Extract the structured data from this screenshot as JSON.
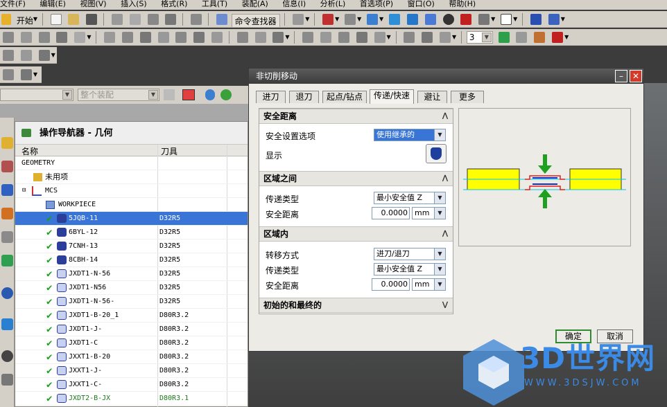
{
  "menubar": {
    "items": [
      "文件(F)",
      "编辑(E)",
      "视图(V)",
      "插入(S)",
      "格式(R)",
      "工具(T)",
      "装配(A)",
      "信息(I)",
      "分析(L)",
      "首选项(P)",
      "窗口(O)",
      "帮助(H)"
    ]
  },
  "toolbar": {
    "start_label": "开始",
    "command_finder_label": "命令查找器",
    "layer_value": "3"
  },
  "filter_bar": {
    "assembly_placeholder": "整个装配"
  },
  "navigator": {
    "title": "操作导航器 - 几何",
    "col_name": "名称",
    "col_tool": "刀具",
    "rows": [
      {
        "name": "GEOMETRY",
        "tool": ""
      },
      {
        "name": "未用项",
        "tool": ""
      },
      {
        "name": "MCS",
        "tool": ""
      },
      {
        "name": "WORKPIECE",
        "tool": ""
      },
      {
        "name": "5JQB-11",
        "tool": "D32R5"
      },
      {
        "name": "6BYL-12",
        "tool": "D32R5"
      },
      {
        "name": "7CNH-13",
        "tool": "D32R5"
      },
      {
        "name": "8CBH-14",
        "tool": "D32R5"
      },
      {
        "name": "JXDT1-N-56",
        "tool": "D32R5"
      },
      {
        "name": "JXDT1-N56",
        "tool": "D32R5"
      },
      {
        "name": "JXDT1-N-56-",
        "tool": "D32R5"
      },
      {
        "name": "JXDT1-B-20_1",
        "tool": "D80R3.2"
      },
      {
        "name": "JXDT1-J-",
        "tool": "D80R3.2"
      },
      {
        "name": "JXDT1-C",
        "tool": "D80R3.2"
      },
      {
        "name": "JXXT1-B-20",
        "tool": "D80R3.2"
      },
      {
        "name": "JXXT1-J-",
        "tool": "D80R3.2"
      },
      {
        "name": "JXXT1-C-",
        "tool": "D80R3.2"
      },
      {
        "name": "JXDT2-B-JX",
        "tool": "D80R3.1"
      }
    ]
  },
  "dialog": {
    "title": "非切削移动",
    "tabs": [
      "进刀",
      "退刀",
      "起点/钻点",
      "传递/快速",
      "避让",
      "更多"
    ],
    "active_tab": "传递/快速",
    "sections": {
      "safe": {
        "title": "安全距离",
        "option_label": "安全设置选项",
        "option_value": "使用继承的",
        "display_label": "显示"
      },
      "between": {
        "title": "区域之间",
        "type_label": "传递类型",
        "type_value": "最小安全值 Z",
        "dist_label": "安全距离",
        "dist_value": "0.0000",
        "dist_unit": "mm"
      },
      "within": {
        "title": "区域内",
        "move_label": "转移方式",
        "move_value": "进刀/退刀",
        "type_label": "传递类型",
        "type_value": "最小安全值 Z",
        "dist_label": "安全距离",
        "dist_value": "0.0000",
        "dist_unit": "mm"
      },
      "initial": {
        "title": "初始的和最终的"
      }
    },
    "ok_label": "确定",
    "cancel_label": "取消"
  },
  "watermark": {
    "text": "3D世界网",
    "url": "WWW.3DSJW.COM"
  },
  "colors": {
    "selection": "#3875d7",
    "check": "#1aa01a",
    "title_bar": "#3c3c3c",
    "ok_border": "#2e8b2e"
  }
}
